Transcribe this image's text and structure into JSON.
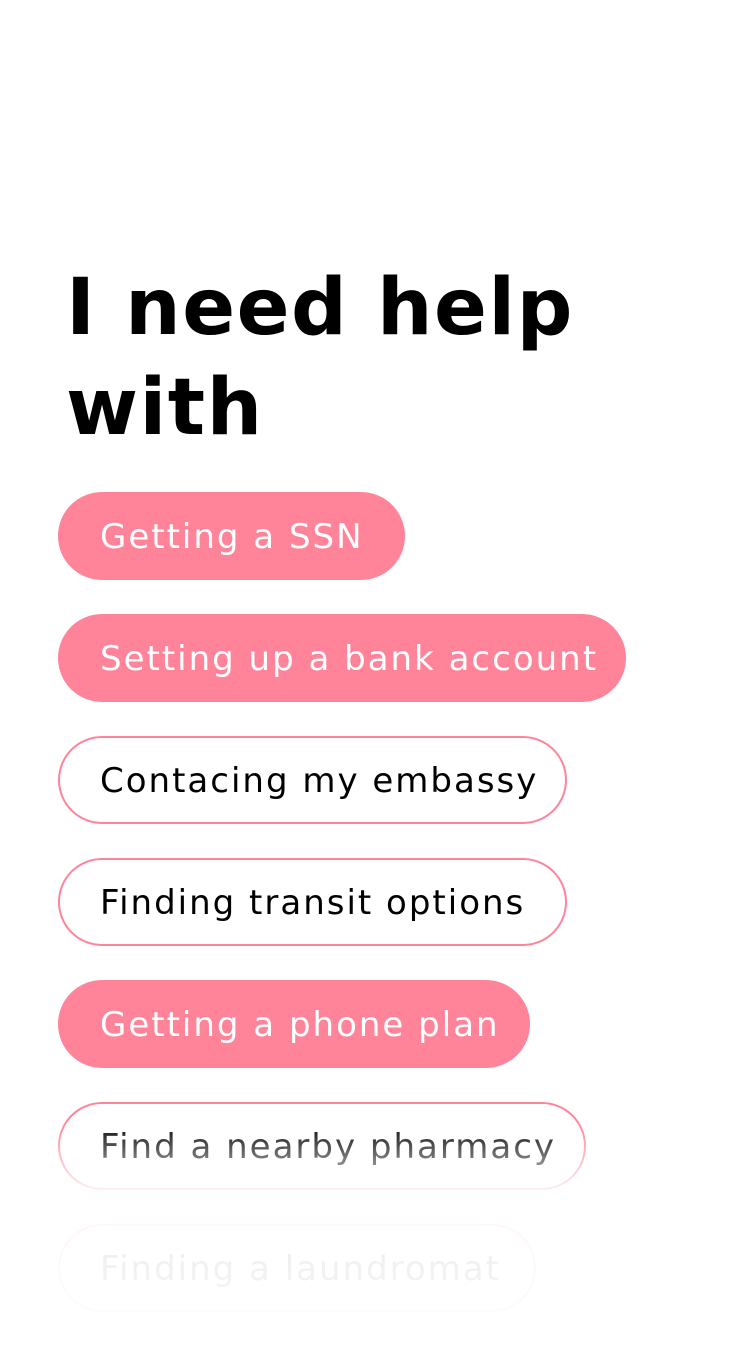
{
  "header": {
    "title": "I need help with"
  },
  "options": [
    {
      "label": "Getting a SSN",
      "selected": true
    },
    {
      "label": "Setting up a bank account",
      "selected": true
    },
    {
      "label": "Contacing my embassy",
      "selected": false
    },
    {
      "label": "Finding transit options",
      "selected": false
    },
    {
      "label": "Getting a phone plan",
      "selected": true
    },
    {
      "label": "Find a nearby pharmacy",
      "selected": false
    },
    {
      "label": "Finding a laundromat",
      "selected": false
    }
  ],
  "colors": {
    "accent": "#ff8499",
    "background": "#ffffff",
    "text": "#000000"
  }
}
